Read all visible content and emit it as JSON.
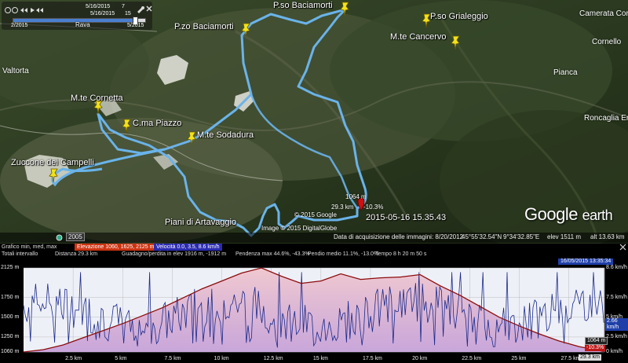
{
  "time_slider": {
    "date_top": "5/16/2015",
    "date_top_count": "7",
    "date_mid": "5/16/2015",
    "date_mid_count": "15",
    "left_label": "2/2015",
    "right_label": "5/2015",
    "value": 0.92
  },
  "places": {
    "baciamorti_pass": "P.so Baciamorti",
    "baciamorti_peak": "P.zo Baciamorti",
    "grialeggio": "P.so Grialeggio",
    "cancervo": "M.te Cancervo",
    "cornetta": "M.te Cornetta",
    "piazzo": "C.ma Piazzo",
    "sodadura": "M.te Sodadura",
    "zuccone": "Zuccone dei Campelli",
    "piani": "Piani di Artavaggio",
    "valtorta": "Valtorta",
    "camerata": "Camerata Cornello",
    "cornello": "Cornello",
    "pianca": "Pianca",
    "roncaglia": "Roncaglia En",
    "rava": "Rava"
  },
  "cursor": {
    "elevation": "1064 m",
    "distance": "29.3 km",
    "grade": "-10.3%",
    "timestamp": "2015-05-16 15.35.43"
  },
  "map_credits": {
    "copyright1": "© 2015 Google",
    "copyright2": "Image © 2015 DigitalGlobe",
    "year_badge": "2005",
    "logo_google": "Google",
    "logo_earth": "earth"
  },
  "status_bar": {
    "imagery_date": "Data di acquisizione delle immagini: 8/20/2012",
    "lat": "45°55'32.54\"N",
    "lon": "9°34'32.85\"E",
    "elev": "elev  1511 m",
    "eye_alt": "alt  13.63 km"
  },
  "profile_info": {
    "row1_label": "Grafico  min, med, max",
    "row1_elev": "Elevazione  1060, 1625, 2125 m",
    "row1_speed": "Velocità  0.0, 3.5, 8.6 km/h",
    "row2_label": "Totali intervallo",
    "row2_distance": "Distanza  29.3 km",
    "row2_gain": "Guadagno/perdita in elev  1916 m, -1912 m",
    "row2_maxgrade": "Pendenza max  44.6%, -43.3%",
    "row2_avggrade": "Pendio medio  11.1%, -13.0%",
    "row2_time": "Tempo  8 h 20 m 50 s"
  },
  "profile_labels": {
    "cursor_date": "16/05/2015 13:35:34",
    "end_elev": "1064 m",
    "end_grade": "-10.3%",
    "end_dist": "29.3 km",
    "speed_cursor": "2.66 km/h",
    "y_left": [
      "2125 m",
      "1750 m",
      "1500 m",
      "1250 m",
      "1060 m"
    ],
    "y_right": [
      "8.6 km/h",
      "7.5 km/h",
      "5 km/h",
      "2.5 km/h",
      "0 km/h"
    ],
    "x_ticks": [
      "2.5 km",
      "5 km",
      "7.5 km",
      "10 km",
      "12.5 km",
      "15 km",
      "17.5 km",
      "20 km",
      "22.5 km",
      "25 km",
      "27.5 km"
    ]
  },
  "chart_data": {
    "type": "area",
    "series": [
      {
        "name": "Elevazione",
        "x": [
          0,
          1,
          2,
          3,
          4,
          5,
          6,
          7,
          8,
          9,
          10,
          11,
          12,
          13,
          14,
          15,
          16,
          17,
          18,
          19,
          20,
          21,
          22,
          23,
          24,
          25,
          26,
          27,
          28,
          29.3
        ],
        "values": [
          1060,
          1090,
          1150,
          1240,
          1330,
          1420,
          1520,
          1620,
          1740,
          1860,
          1960,
          2060,
          2125,
          2020,
          1930,
          1960,
          2050,
          1980,
          2000,
          2010,
          2040,
          1900,
          1780,
          1640,
          1500,
          1390,
          1290,
          1200,
          1130,
          1064
        ]
      }
    ],
    "ylim": [
      1060,
      2125
    ],
    "xlim": [
      0,
      29.3
    ]
  },
  "colors": {
    "track": "#5fa8e0",
    "elevation_line": "#8a0c0c",
    "speed_line": "#1b2a8a",
    "pin": "#f2e21a"
  }
}
